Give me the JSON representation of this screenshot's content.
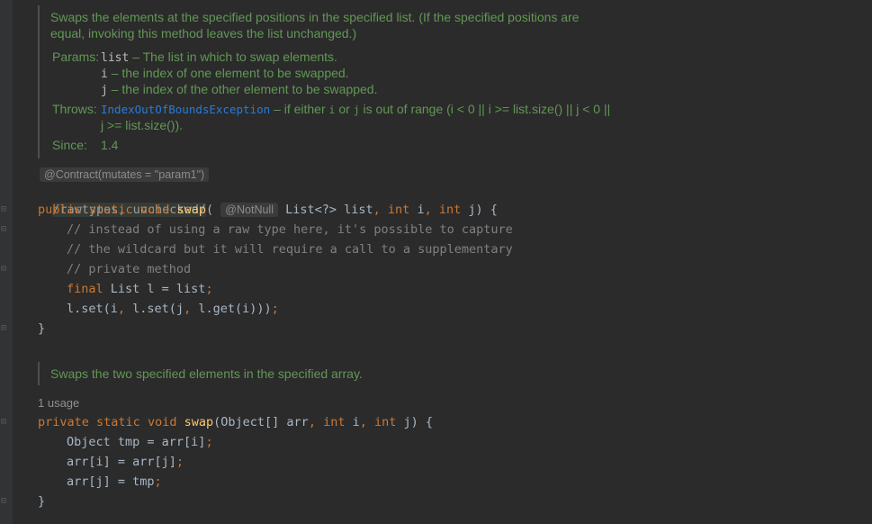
{
  "doc1": {
    "summary_line1": "Swaps the elements at the specified positions in the specified list. (If the specified positions are",
    "summary_line2": "equal, invoking this method leaves the list unchanged.)",
    "params_label": "Params:",
    "param1_name": "list",
    "param1_desc": " – The list in which to swap elements.",
    "param2_name": "i",
    "param2_desc": " – the index of one element to be swapped.",
    "param3_name": "j",
    "param3_desc": " – the index of the other element to be swapped.",
    "throws_label": "Throws:",
    "throws_exception": "IndexOutOfBoundsException",
    "throws_desc_a": " – if either ",
    "throws_i": "i",
    "throws_desc_b": " or ",
    "throws_j": "j",
    "throws_desc_c": " is out of range (i < 0 || i >= list.size() || j < 0 ||",
    "throws_desc_line2": "j >= list.size()).",
    "since_label": "Since:",
    "since_value": "1.4"
  },
  "contract_inlay": "@Contract(mutates = \"param1\")",
  "suppress_text": "/rawtypes, unchecked/",
  "method1": {
    "sig_public": "public",
    "sig_static": "static",
    "sig_void": "void",
    "name": "swap",
    "paren_open": "(",
    "notnull_inlay": "@NotNull",
    "param1": " List<?> list",
    "comma1": ", ",
    "int1": "int",
    "param2": " i",
    "comma2": ", ",
    "int2": "int",
    "param3": " j) {",
    "comment1": "// instead of using a raw type here, it's possible to capture",
    "comment2": "// the wildcard but it will require a call to a supplementary",
    "comment3": "// private method",
    "final_kw": "final",
    "final_rest": " List l = list",
    "semi": ";",
    "set_a": "l.set(i",
    "set_comma1": ", ",
    "set_b": "l.set(j",
    "set_comma2": ", ",
    "set_c": "l.get(i)))",
    "set_semi": ";",
    "close": "}"
  },
  "doc2": {
    "summary": "Swaps the two specified elements in the specified array."
  },
  "usage_label": "1 usage",
  "method2": {
    "sig_private": "private",
    "sig_static": "static",
    "sig_void": "void",
    "name": "swap",
    "param1": "(Object[] arr",
    "comma1": ", ",
    "int1": "int",
    "param2": " i",
    "comma2": ", ",
    "int2": "int",
    "param3": " j) {",
    "line1": "Object tmp = arr[i]",
    "line2": "arr[i] = arr[j]",
    "line3": "arr[j] = tmp",
    "semi": ";",
    "close": "}"
  }
}
